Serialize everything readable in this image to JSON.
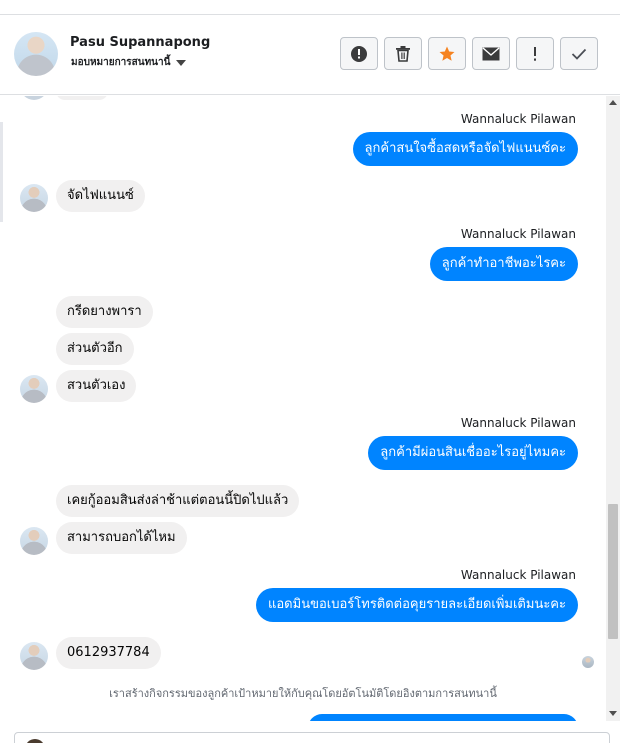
{
  "contact": {
    "name": "Pasu Supannapong",
    "assign_label": "มอบหมายการสนทนานี้"
  },
  "toolbar": {
    "buttons": [
      {
        "name": "mark-spam-button",
        "icon": "exclamation-circle-icon"
      },
      {
        "name": "delete-button",
        "icon": "trash-icon"
      },
      {
        "name": "star-button",
        "icon": "star-icon",
        "color": "#f5821f"
      },
      {
        "name": "mark-unread-button",
        "icon": "envelope-icon"
      },
      {
        "name": "follow-up-button",
        "icon": "exclamation-icon"
      },
      {
        "name": "mark-done-button",
        "icon": "check-icon"
      }
    ]
  },
  "colors": {
    "outgoing_bubble": "#0084ff",
    "incoming_bubble": "#f1f0f0",
    "star": "#f5821f"
  },
  "messages": {
    "m1_sender": "Wannaluck Pilawan",
    "m1_text": "ลูกค้าสนใจซื้อสดหรือจัดไฟแนนซ์คะ",
    "m2_text": "จัดไฟแนนซ์",
    "m3_sender": "Wannaluck Pilawan",
    "m3_text": "ลูกค้าทำอาชีพอะไรคะ",
    "m4_text": "กรีดยางพารา",
    "m5_text": "ส่วนตัวอีก",
    "m6_text": "สวนตัวเอง",
    "m7_sender": "Wannaluck Pilawan",
    "m7_text": "ลูกค้ามีผ่อนสินเชื่ออะไรอยู่ไหมคะ",
    "m8_text": "เคยกู้ออมสินส่งล่าช้าแต่ตอนนี้ปิดไปแล้ว",
    "m9_text": "สามารถบอกได้ไหม",
    "m10_sender": "Wannaluck Pilawan",
    "m10_text": "แอดมินขอเบอร์โทรติดต่อคุยรายละเอียดเพิ่มเติมนะคะ",
    "m11_text": "0612937784"
  },
  "system_notice": "เราสร้างกิจกรรมของลูกค้าเป้าหมายให้กับคุณโดยอัตโนมัติโดยอิงตามการสนทนานี้"
}
